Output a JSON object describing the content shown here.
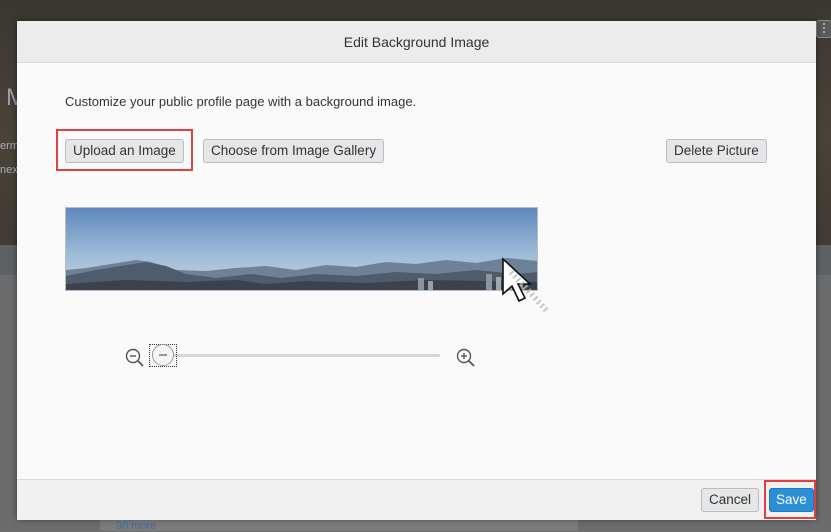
{
  "background_page": {
    "heading_fragment": "M",
    "text_fragments": [
      "erm",
      "nex"
    ],
    "more_link": "90 more"
  },
  "dialog": {
    "title": "Edit Background Image",
    "description": "Customize your public profile page with a background image.",
    "buttons": {
      "upload": "Upload an Image",
      "gallery": "Choose from Image Gallery",
      "delete": "Delete Picture"
    },
    "zoom": {
      "level": 0,
      "out_icon": "zoom-out-icon",
      "in_icon": "zoom-in-icon"
    },
    "footer": {
      "cancel": "Cancel",
      "save": "Save"
    }
  },
  "colors": {
    "highlight": "#e0403f",
    "save_button": "#2b8fd6"
  }
}
